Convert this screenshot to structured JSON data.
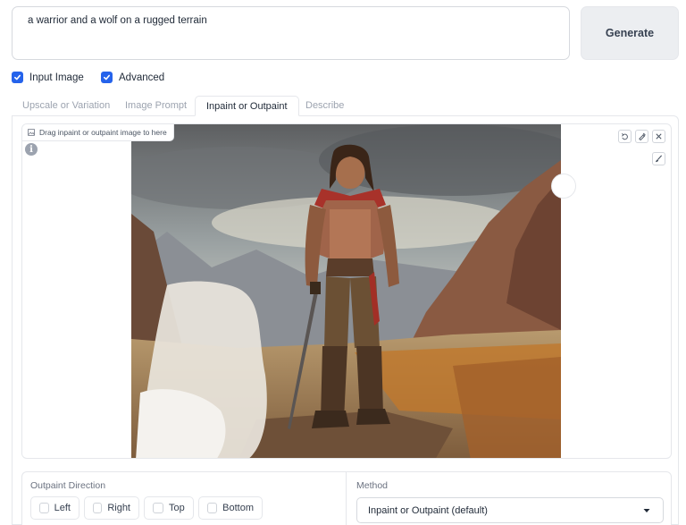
{
  "prompt": {
    "value": "a warrior and a wolf on a rugged terrain"
  },
  "generate_button": {
    "label": "Generate"
  },
  "checkboxes": [
    {
      "label": "Input Image",
      "checked": true
    },
    {
      "label": "Advanced",
      "checked": true
    }
  ],
  "tabs": [
    {
      "label": "Upscale or Variation",
      "active": false
    },
    {
      "label": "Image Prompt",
      "active": false
    },
    {
      "label": "Inpaint or Outpaint",
      "active": true
    },
    {
      "label": "Describe",
      "active": false
    }
  ],
  "image_input": {
    "drag_label": "Drag inpaint or outpaint image to here",
    "info_icon": "info-icon",
    "toolbar_icons": [
      "undo-icon",
      "brush-clear-icon",
      "close-icon"
    ],
    "brush_icon": "brush-icon"
  },
  "outpaint": {
    "label": "Outpaint Direction",
    "options": [
      {
        "label": "Left",
        "checked": false
      },
      {
        "label": "Right",
        "checked": false
      },
      {
        "label": "Top",
        "checked": false
      },
      {
        "label": "Bottom",
        "checked": false
      }
    ]
  },
  "method": {
    "label": "Method",
    "selected": "Inpaint or Outpaint (default)"
  },
  "colors": {
    "accent": "#2563eb",
    "border": "#e5e7eb"
  }
}
